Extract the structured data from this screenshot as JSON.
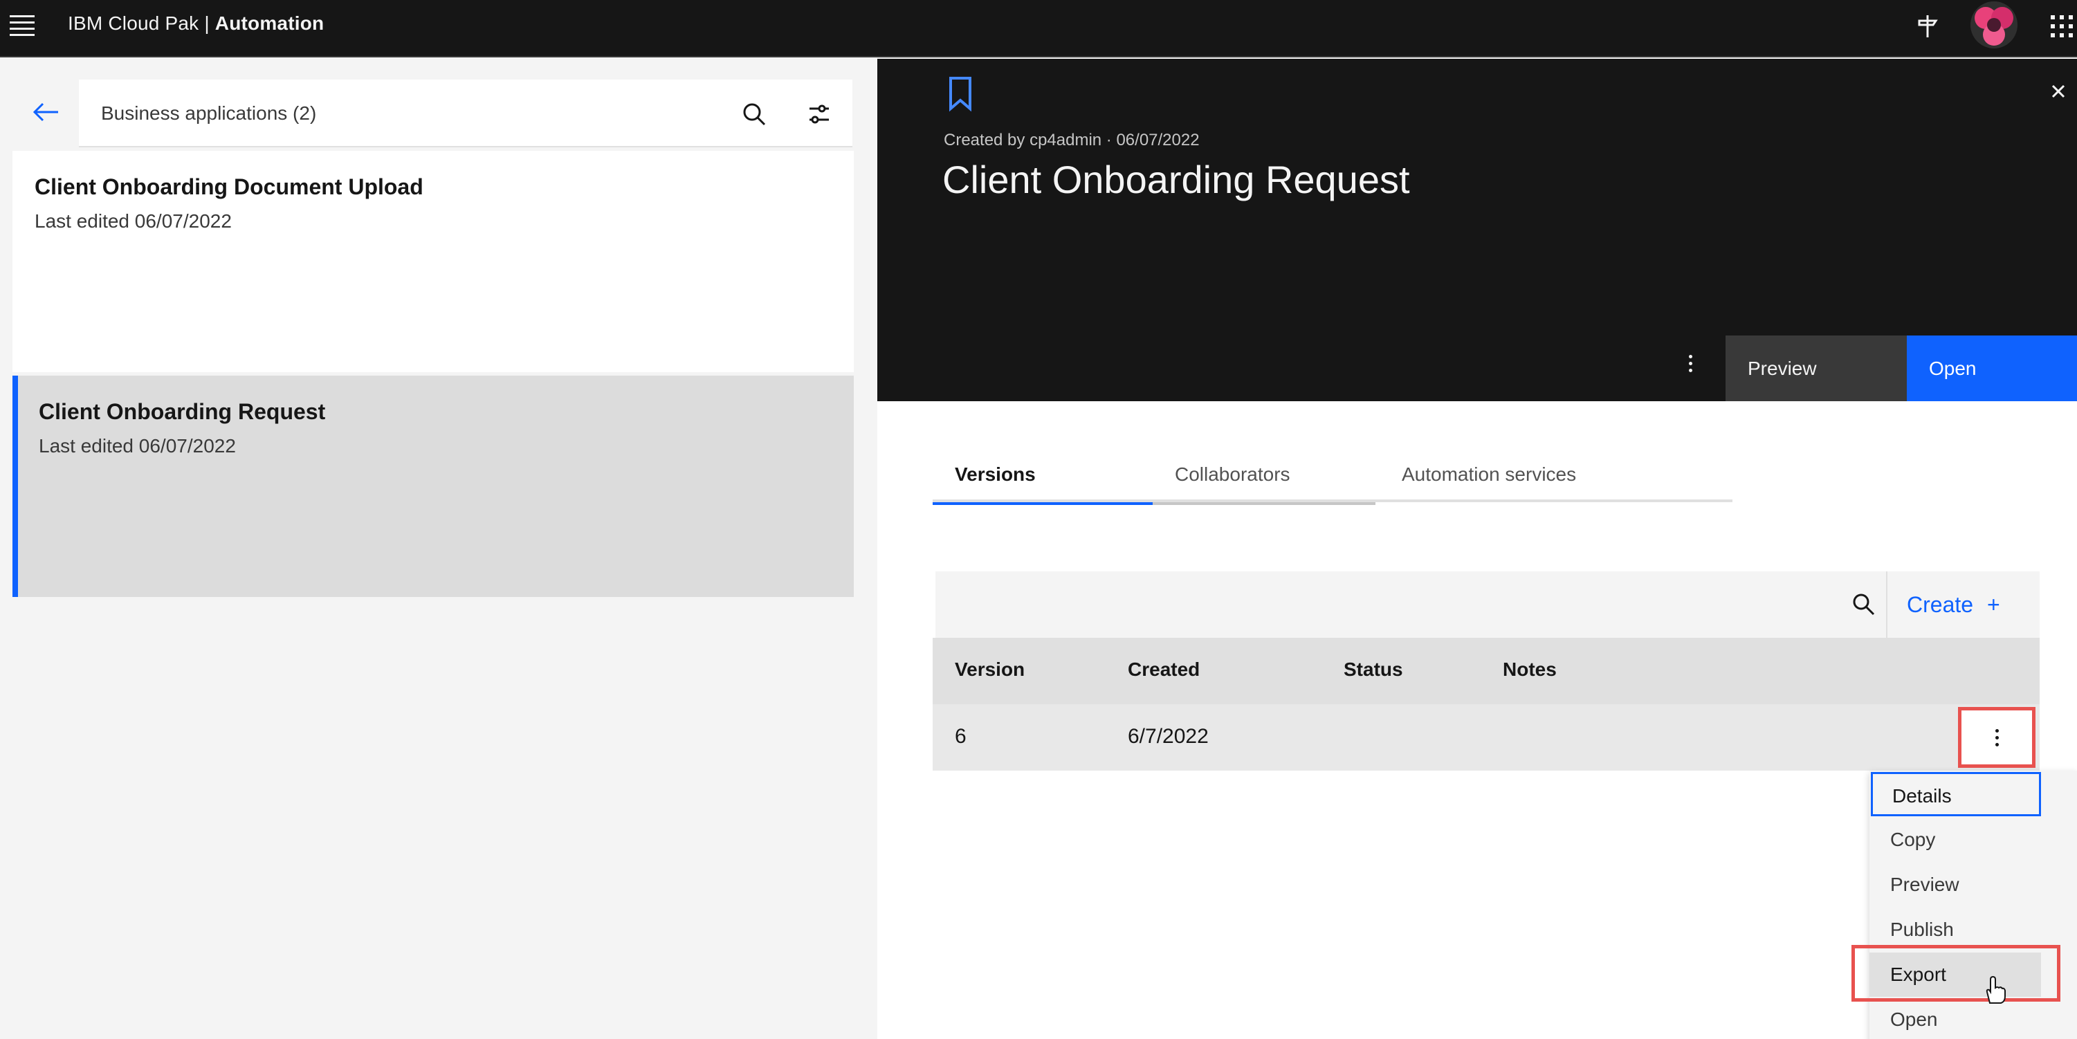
{
  "topbar": {
    "brand_prefix": "IBM Cloud Pak | ",
    "brand_name": "Automation",
    "icons": [
      "menu-icon",
      "pin-icon",
      "avatar",
      "app-switcher-icon"
    ]
  },
  "left_panel": {
    "search_label": "Business applications (2)",
    "items": [
      {
        "title": "Client Onboarding Document Upload",
        "subtitle": "Last edited 06/07/2022"
      },
      {
        "title": "Client Onboarding Request",
        "subtitle": "Last edited 06/07/2022"
      }
    ]
  },
  "detail": {
    "created_by": "Created by cp4admin · 06/07/2022",
    "title": "Client Onboarding Request",
    "preview_label": "Preview",
    "open_label": "Open"
  },
  "tabs": [
    "Versions",
    "Collaborators",
    "Automation services"
  ],
  "table": {
    "create_label": "Create",
    "create_icon": "+",
    "columns": [
      "Version",
      "Created",
      "Status",
      "Notes"
    ],
    "rows": [
      {
        "version": "6",
        "created": "6/7/2022",
        "status": "",
        "notes": ""
      }
    ]
  },
  "row_menu": {
    "items": [
      "Details",
      "Copy",
      "Preview",
      "Publish",
      "Export",
      "Open"
    ]
  },
  "colors": {
    "accent": "#0f62fe",
    "header_bg": "#161616",
    "highlight": "#e8524f"
  }
}
